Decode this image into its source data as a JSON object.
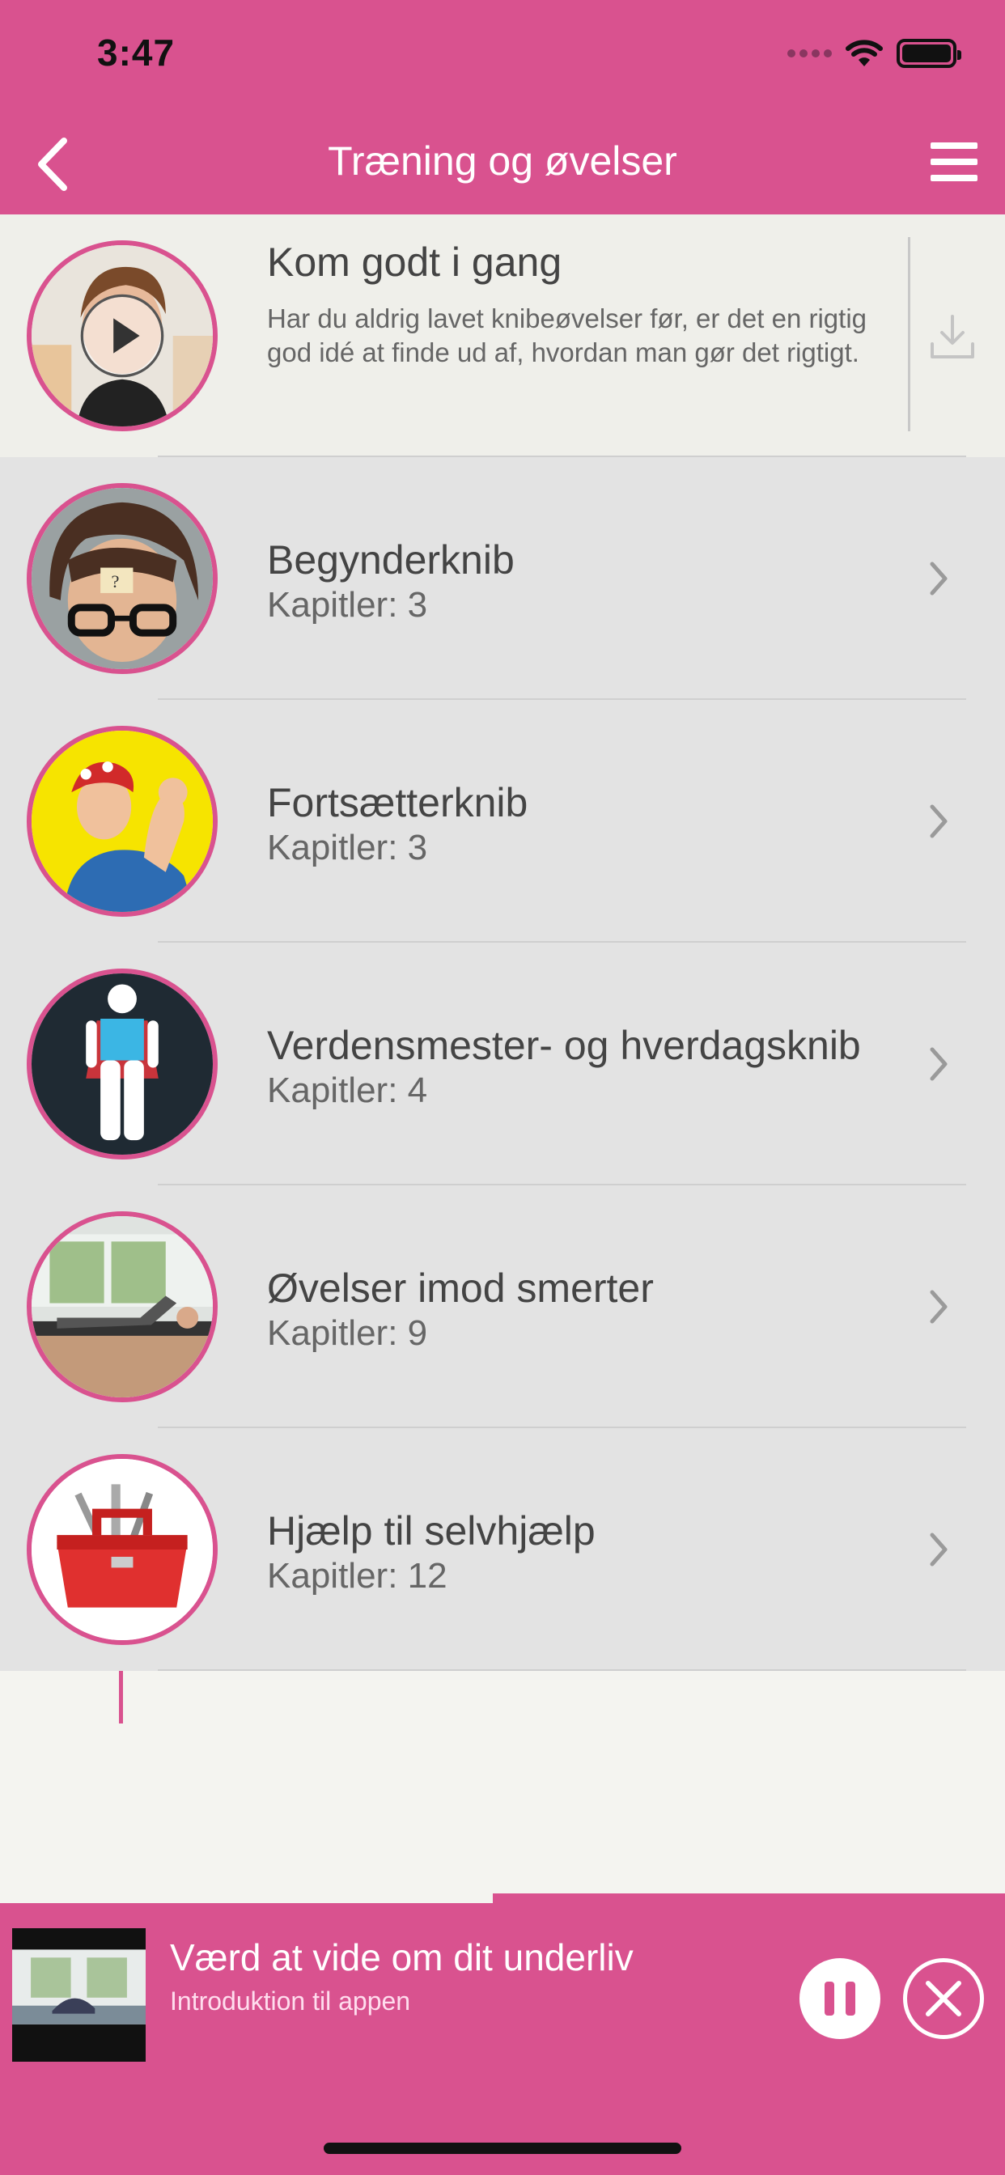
{
  "status_bar": {
    "time": "3:47"
  },
  "nav": {
    "title": "Træning og øvelser"
  },
  "intro": {
    "title": "Kom godt i gang",
    "description": "Har du aldrig lavet knibeøvelser før, er det en rigtig god idé at finde ud af, hvordan man gør det rigtigt."
  },
  "courses": [
    {
      "title": "Begynderknib",
      "chapters": "Kapitler: 3"
    },
    {
      "title": "Fortsætterknib",
      "chapters": "Kapitler: 3"
    },
    {
      "title": "Verdensmester- og hverdagsknib",
      "chapters": "Kapitler: 4"
    },
    {
      "title": "Øvelser imod smerter",
      "chapters": "Kapitler: 9"
    },
    {
      "title": "Hjælp til selvhjælp",
      "chapters": "Kapitler: 12"
    }
  ],
  "player": {
    "title": "Værd at vide om dit underliv",
    "subtitle": "Introduktion til appen",
    "progress": 0.49
  },
  "colors": {
    "accent": "#d9528f",
    "list_bg": "#e3e3e3",
    "page_bg": "#f4f4f0"
  },
  "icons": [
    "back-chevron-icon",
    "hamburger-menu-icon",
    "play-icon",
    "download-icon",
    "chevron-right-icon",
    "pause-icon",
    "close-icon",
    "wifi-icon",
    "battery-icon"
  ]
}
